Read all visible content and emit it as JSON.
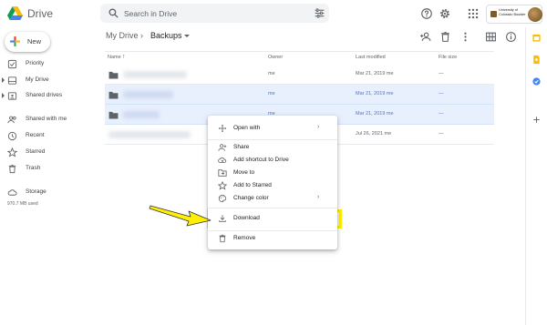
{
  "app": {
    "title": "Drive"
  },
  "search": {
    "placeholder": "Search in Drive"
  },
  "org": {
    "name": "University of Colorado Boulder"
  },
  "sidebar": {
    "new_label": "New",
    "items": [
      {
        "label": "Priority",
        "icon": "priority-icon"
      },
      {
        "label": "My Drive",
        "icon": "my-drive-icon"
      },
      {
        "label": "Shared drives",
        "icon": "shared-drives-icon"
      },
      {
        "label": "Shared with me",
        "icon": "shared-with-me-icon"
      },
      {
        "label": "Recent",
        "icon": "clock-icon"
      },
      {
        "label": "Starred",
        "icon": "star-icon"
      },
      {
        "label": "Trash",
        "icon": "trash-icon"
      },
      {
        "label": "Storage",
        "icon": "cloud-icon"
      }
    ],
    "storage_used": "970.7 MB used"
  },
  "breadcrumb": {
    "root": "My Drive",
    "separator": "›",
    "current": "Backups"
  },
  "table": {
    "columns": {
      "name": "Name",
      "owner": "Owner",
      "modified": "Last modified",
      "size": "File size"
    },
    "rows": [
      {
        "owner": "me",
        "modified": "Mar 21, 2019 me",
        "size": "—",
        "selected": false
      },
      {
        "owner": "me",
        "modified": "Mar 21, 2019 me",
        "size": "—",
        "selected": true
      },
      {
        "owner": "me",
        "modified": "Mar 21, 2019 me",
        "size": "—",
        "selected": true
      },
      {
        "owner": "me",
        "modified": "Jul 26, 2021 me",
        "size": "—",
        "selected": false
      }
    ]
  },
  "context_menu": {
    "items": [
      {
        "label": "Open with",
        "icon": "open-with-icon",
        "submenu": true
      },
      {
        "label": "Share",
        "icon": "share-icon"
      },
      {
        "label": "Add shortcut to Drive",
        "icon": "add-shortcut-icon"
      },
      {
        "label": "Move to",
        "icon": "move-to-icon"
      },
      {
        "label": "Add to Starred",
        "icon": "star-outline-icon"
      },
      {
        "label": "Change color",
        "icon": "palette-icon",
        "submenu": true
      },
      {
        "label": "Download",
        "icon": "download-icon",
        "highlighted": true
      },
      {
        "label": "Remove",
        "icon": "trash-icon"
      }
    ],
    "submenu_glyph": "›"
  },
  "colors": {
    "accent": "#1a73e8",
    "selected_row": "#e8f0fe",
    "highlight": "#ffef00"
  }
}
